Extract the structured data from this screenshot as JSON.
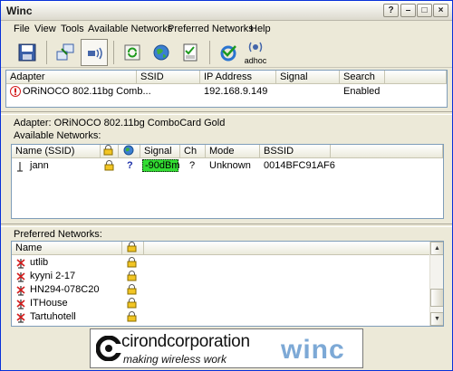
{
  "window": {
    "title": "Winc"
  },
  "title_buttons": {
    "help": "?",
    "minimize": "–",
    "maximize": "□",
    "close": "×"
  },
  "menu": [
    "File",
    "View",
    "Tools",
    "Available Networks",
    "Preferred Networks",
    "Help"
  ],
  "toolbar": {
    "adhoc_label": "adhoc"
  },
  "adapters": {
    "columns": [
      "Adapter",
      "SSID",
      "IP Address",
      "Signal",
      "Search"
    ],
    "rows": [
      {
        "adapter": "ORiNOCO 802.11bg Comb...",
        "ssid": "",
        "ip": "192.168.9.149",
        "signal": "",
        "search": "Enabled"
      }
    ]
  },
  "available": {
    "adapter_line": "Adapter: ORiNOCO 802.11bg ComboCard Gold",
    "label": "Available Networks:",
    "columns": {
      "name": "Name (SSID)",
      "signal": "Signal",
      "ch": "Ch",
      "mode": "Mode",
      "bssid": "BSSID"
    },
    "rows": [
      {
        "name": "jann",
        "security": "?",
        "signal": "-90dBm",
        "ch": "?",
        "mode": "Unknown",
        "bssid": "0014BFC91AF6"
      }
    ],
    "signal_color": "#33dd33"
  },
  "preferred": {
    "label": "Preferred Networks:",
    "columns": {
      "name": "Name"
    },
    "rows": [
      "utlib",
      "kyyni 2-17",
      "HN294-078C20",
      "ITHouse",
      "Tartuhotell"
    ]
  },
  "banner": {
    "company": "cirondcorporation",
    "tagline": "making wireless work",
    "product": "winc"
  },
  "colors": {
    "accent": "#0831d9",
    "error_icon": "#d41d1d",
    "product_blue": "#7da9d6"
  }
}
